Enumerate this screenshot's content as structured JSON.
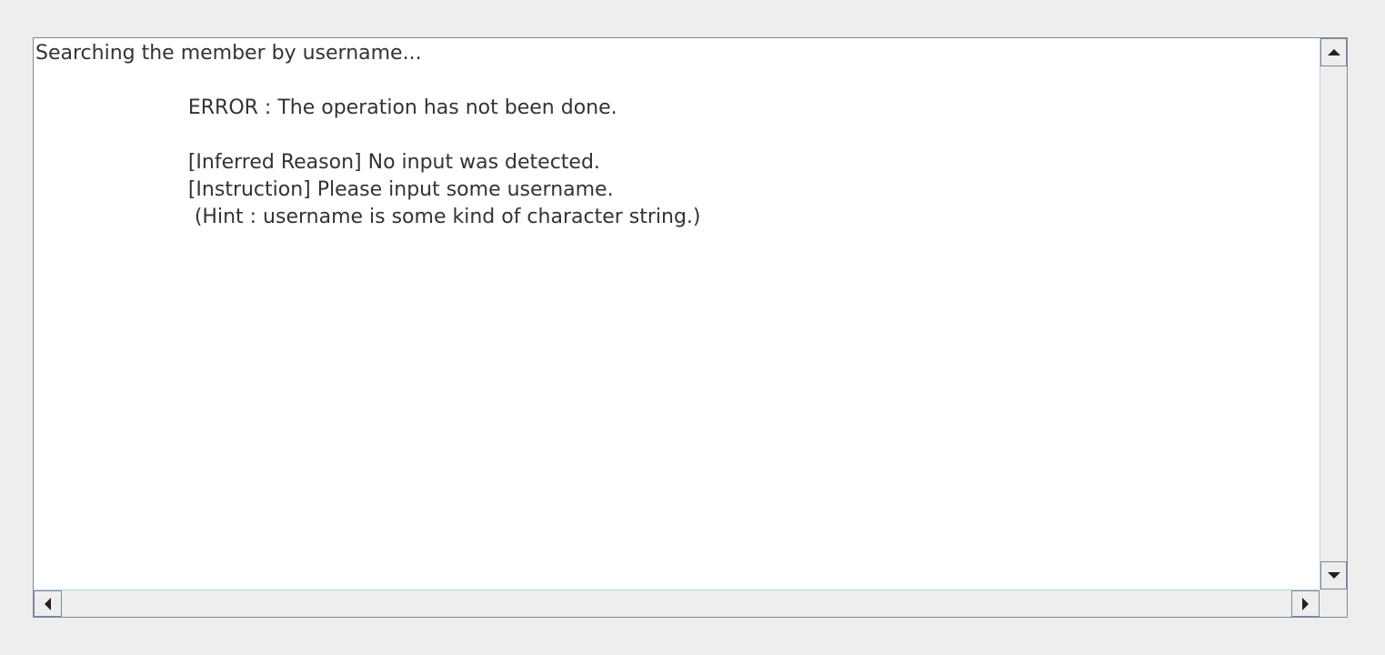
{
  "console": {
    "text": "Searching the member by username...\n\n\t\t\tERROR : The operation has not been done.\n\n\t\t\t[Inferred Reason] No input was detected.\n\t\t\t[Instruction] Please input some username.\n\t\t\t (Hint : username is some kind of character string.)"
  },
  "scrollbars": {
    "vertical": {
      "up_icon": "arrow-up-icon",
      "down_icon": "arrow-down-icon"
    },
    "horizontal": {
      "left_icon": "arrow-left-icon",
      "right_icon": "arrow-right-icon"
    }
  },
  "colors": {
    "window_bg": "#eeeeee",
    "text_area_bg": "#ffffff",
    "border": "#7a8a99",
    "text": "#333333"
  }
}
